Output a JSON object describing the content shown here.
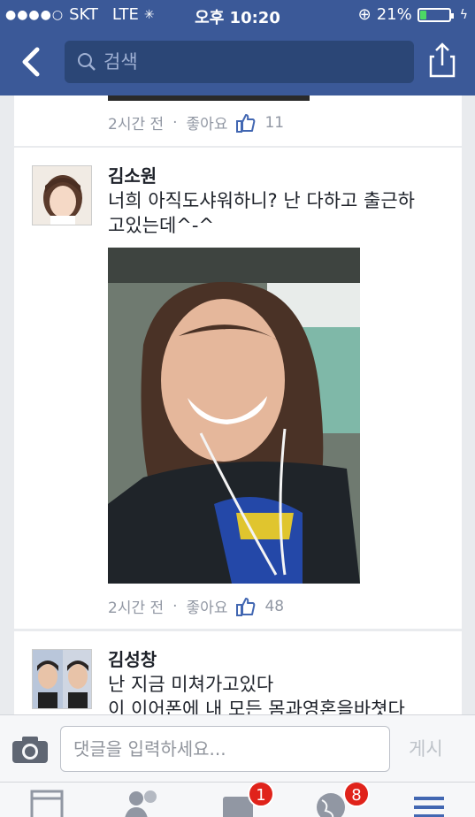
{
  "status_bar": {
    "signal": "●●●●○",
    "carrier": "SKT",
    "network": "LTE",
    "time": "오후 10:20",
    "battery": "21%",
    "battery_level": 0.21
  },
  "search": {
    "placeholder": "검색"
  },
  "posts": [
    {
      "time": "2시간 전",
      "like_label": "좋아요",
      "like_count": "11"
    },
    {
      "name": "김소원",
      "text_line1": "너희 아직도샤워하니? 난 다하고 출근하",
      "text_line2": "고있는데^-^",
      "time": "2시간 전",
      "like_label": "좋아요",
      "like_count": "48"
    },
    {
      "name": "김성창",
      "text_line1": "난 지금 미쳐가고있다",
      "text_line2": "이 이어폰에 내 모든 몸과영혼을바쳣다"
    }
  ],
  "separator": "·",
  "comment_bar": {
    "placeholder": "댓글을 입력하세요...",
    "post_label": "게시"
  },
  "tabbar": {
    "messages_badge": "1",
    "notifications_badge": "8"
  },
  "icons": [
    "back-icon",
    "search-icon",
    "share-icon",
    "thumbs-up-icon",
    "camera-icon",
    "news-feed-icon",
    "friends-icon",
    "messages-icon",
    "globe-icon",
    "menu-icon"
  ],
  "colors": {
    "header": "#3b5998",
    "badge": "#e0231b",
    "battery": "#4cd964"
  }
}
